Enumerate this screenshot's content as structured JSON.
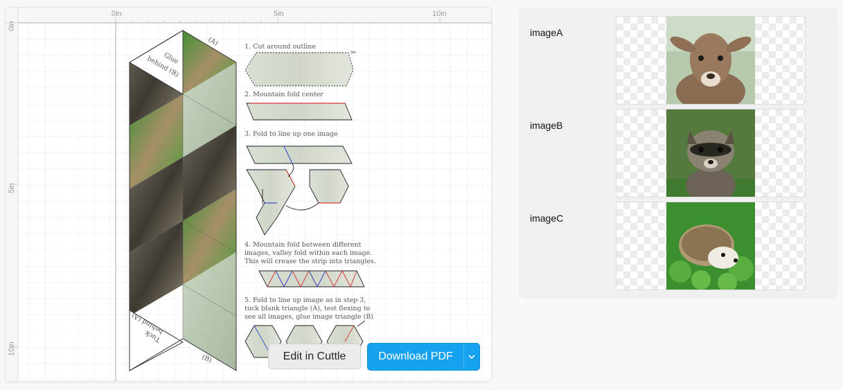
{
  "canvas": {
    "ruler": {
      "h_labels": [
        "0in",
        "5in",
        "10in"
      ],
      "v_labels": [
        "0in",
        "5in",
        "10in"
      ]
    },
    "strip": {
      "tab_top": {
        "line1": "Glue",
        "line2": "behind (B)"
      },
      "tab_bottom": {
        "line1": "Tuck",
        "line2": "behind (A)"
      },
      "label_a": "(A)",
      "label_b": "(B)"
    },
    "instructions": [
      {
        "lines": [
          "1. Cut around outline"
        ]
      },
      {
        "lines": [
          "2. Mountain fold center"
        ]
      },
      {
        "lines": [
          "3. Fold to line up one image"
        ]
      },
      {
        "lines": [
          "4. Mountain fold between different",
          " images, valley fold within each image.",
          " This will crease the strip into triangles."
        ]
      },
      {
        "lines": [
          "5. Fold to line up image as in step 3,",
          " tuck blank triangle (A), test flexing to",
          " see all images, glue image triangle (B)"
        ]
      }
    ]
  },
  "buttons": {
    "edit": "Edit in Cuttle",
    "download": "Download PDF",
    "download_menu_icon": "chevron-down-icon"
  },
  "parameters": [
    {
      "label": "imageA",
      "image": "lamb-photo"
    },
    {
      "label": "imageB",
      "image": "raccoon-photo"
    },
    {
      "label": "imageC",
      "image": "hedgehog-photo"
    }
  ],
  "colors": {
    "accent": "#17a2ef",
    "mountain_fold": "#d23a3a",
    "valley_fold": "#3a56d2"
  }
}
